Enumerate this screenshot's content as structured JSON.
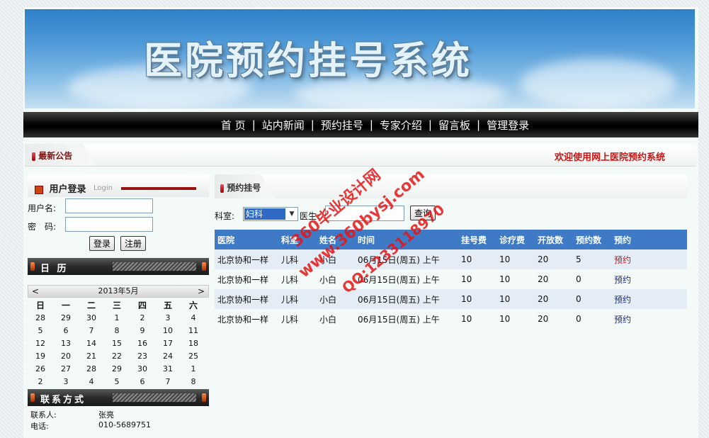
{
  "banner": {
    "title": "医院预约挂号系统"
  },
  "nav": {
    "items": [
      "首 页",
      "站内新闻",
      "预约挂号",
      "专家介绍",
      "留言板",
      "管理登录"
    ],
    "separator": "|"
  },
  "notice": {
    "label": "最新公告",
    "welcome": "欢迎使用网上医院预约系统"
  },
  "login": {
    "title": "用户登录",
    "subtitle": "Login",
    "username_label": "用户名:",
    "password_label": "密　码:",
    "login_button": "登录",
    "register_button": "注册"
  },
  "calendar": {
    "title": "日 历",
    "prev": "<",
    "next": ">",
    "month_label": "2013年5月",
    "weekdays": [
      "日",
      "一",
      "二",
      "三",
      "四",
      "五",
      "六"
    ],
    "weeks": [
      [
        "28",
        "29",
        "30",
        "1",
        "2",
        "3",
        "4"
      ],
      [
        "5",
        "6",
        "7",
        "8",
        "9",
        "10",
        "11"
      ],
      [
        "12",
        "13",
        "14",
        "15",
        "16",
        "17",
        "18"
      ],
      [
        "19",
        "20",
        "21",
        "22",
        "23",
        "24",
        "25"
      ],
      [
        "26",
        "27",
        "28",
        "29",
        "30",
        "31",
        "1"
      ],
      [
        "2",
        "3",
        "4",
        "5",
        "6",
        "7",
        "8"
      ]
    ]
  },
  "contact": {
    "title": "联系方式",
    "rows": [
      {
        "k": "联系人:",
        "v": "张亮"
      },
      {
        "k": "电话:",
        "v": "010-5689751"
      }
    ]
  },
  "appointment": {
    "title": "预约挂号",
    "dept_label": "科室:",
    "dept_value": "妇科",
    "doctor_label": "医生:",
    "doctor_value": "",
    "query_button": "查询",
    "columns": [
      "医院",
      "科室",
      "姓名",
      "时间",
      "挂号费",
      "诊疗费",
      "开放数",
      "预约数",
      "预约"
    ],
    "rows": [
      [
        "北京协和一样",
        "儿科",
        "小白",
        "06月15日(周五) 上午",
        "10",
        "10",
        "20",
        "5",
        "预约"
      ],
      [
        "北京协和一样",
        "儿科",
        "小白",
        "06月15日(周五) 上午",
        "10",
        "10",
        "20",
        "0",
        "预约"
      ],
      [
        "北京协和一样",
        "儿科",
        "小白",
        "06月15日(周五) 上午",
        "10",
        "10",
        "20",
        "0",
        "预约"
      ],
      [
        "北京协和一样",
        "儿科",
        "小白",
        "06月15日(周五) 上午",
        "10",
        "10",
        "20",
        "0",
        "预约"
      ]
    ]
  },
  "watermark": {
    "line1": "360毕业设计网",
    "line2": "www.360bysj.com",
    "line3": "QQ:1233118970"
  }
}
